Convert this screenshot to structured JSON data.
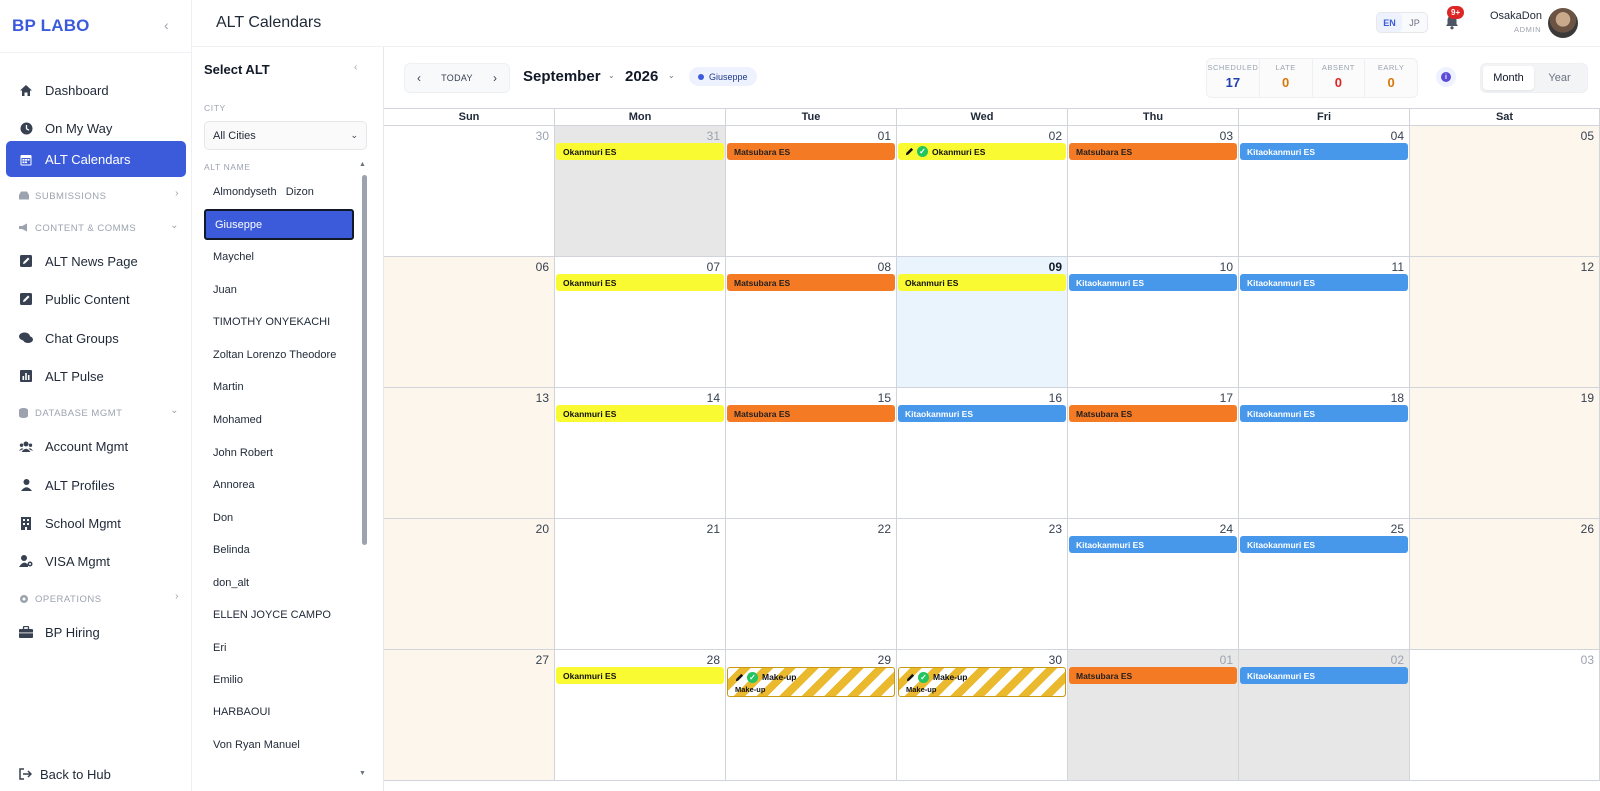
{
  "sidebar": {
    "brand": "BP LABO",
    "items": [
      {
        "label": "Dashboard"
      },
      {
        "label": "On My Way"
      },
      {
        "label": "ALT Calendars"
      },
      {
        "label": "SUBMISSIONS"
      },
      {
        "label": "CONTENT & COMMS"
      },
      {
        "label": "ALT News Page"
      },
      {
        "label": "Public Content"
      },
      {
        "label": "Chat Groups"
      },
      {
        "label": "ALT Pulse"
      },
      {
        "label": "DATABASE MGMT"
      },
      {
        "label": "Account Mgmt"
      },
      {
        "label": "ALT Profiles"
      },
      {
        "label": "School Mgmt"
      },
      {
        "label": "VISA Mgmt"
      },
      {
        "label": "OPERATIONS"
      },
      {
        "label": "BP Hiring"
      }
    ],
    "back_label": "Back to Hub"
  },
  "header": {
    "title": "ALT Calendars",
    "lang_en": "EN",
    "lang_jp": "JP",
    "notif_badge": "9+",
    "user_name": "OsakaDon",
    "user_role": "ADMIN"
  },
  "alt_panel": {
    "title": "Select ALT",
    "city_label": "CITY",
    "city_value": "All Cities",
    "name_label": "ALT NAME",
    "names": [
      "Almondyseth   Dizon",
      "Giuseppe",
      "Maychel",
      "Juan",
      "TIMOTHY ONYEKACHI",
      "Zoltan Lorenzo Theodore",
      "Martin",
      "Mohamed",
      "John Robert",
      "Annorea",
      "Don",
      "Belinda",
      "don_alt",
      "ELLEN JOYCE CAMPO",
      "Eri",
      "Emilio",
      "HARBAOUI",
      "Von Ryan Manuel"
    ],
    "selected": "Giuseppe"
  },
  "toolbar": {
    "today_label": "TODAY",
    "month": "September",
    "year": "2026",
    "chip": "Giuseppe",
    "stats": [
      {
        "label": "SCHEDULED",
        "value": "17",
        "color": "#1e40af"
      },
      {
        "label": "LATE",
        "value": "0",
        "color": "#d97706"
      },
      {
        "label": "ABSENT",
        "value": "0",
        "color": "#dc2626"
      },
      {
        "label": "EARLY",
        "value": "0",
        "color": "#d97706"
      }
    ],
    "info_icon": "i",
    "view_month": "Month",
    "view_year": "Year"
  },
  "calendar": {
    "days": [
      "Sun",
      "Mon",
      "Tue",
      "Wed",
      "Thu",
      "Fri",
      "Sat"
    ],
    "weeks": [
      [
        {
          "d": "30",
          "other": true
        },
        {
          "d": "31",
          "other": true,
          "events": [
            {
              "label": "Okanmuri ES",
              "color": "yellow"
            }
          ]
        },
        {
          "d": "01",
          "events": [
            {
              "label": "Matsubara ES",
              "color": "orange"
            }
          ]
        },
        {
          "d": "02",
          "events": [
            {
              "label": "Okanmuri ES",
              "color": "yellow",
              "check": true
            }
          ]
        },
        {
          "d": "03",
          "events": [
            {
              "label": "Matsubara ES",
              "color": "orange"
            }
          ]
        },
        {
          "d": "04",
          "events": [
            {
              "label": "Kitaokanmuri ES",
              "color": "blue"
            }
          ]
        },
        {
          "d": "05"
        }
      ],
      [
        {
          "d": "06"
        },
        {
          "d": "07",
          "events": [
            {
              "label": "Okanmuri ES",
              "color": "yellow"
            }
          ]
        },
        {
          "d": "08",
          "events": [
            {
              "label": "Matsubara ES",
              "color": "orange"
            }
          ]
        },
        {
          "d": "09",
          "today": true,
          "events": [
            {
              "label": "Okanmuri ES",
              "color": "yellow"
            }
          ]
        },
        {
          "d": "10",
          "events": [
            {
              "label": "Kitaokanmuri ES",
              "color": "blue"
            }
          ]
        },
        {
          "d": "11",
          "events": [
            {
              "label": "Kitaokanmuri ES",
              "color": "blue"
            }
          ]
        },
        {
          "d": "12"
        }
      ],
      [
        {
          "d": "13"
        },
        {
          "d": "14",
          "events": [
            {
              "label": "Okanmuri ES",
              "color": "yellow"
            }
          ]
        },
        {
          "d": "15",
          "events": [
            {
              "label": "Matsubara ES",
              "color": "orange"
            }
          ]
        },
        {
          "d": "16",
          "events": [
            {
              "label": "Kitaokanmuri ES",
              "color": "blue"
            }
          ]
        },
        {
          "d": "17",
          "events": [
            {
              "label": "Matsubara ES",
              "color": "orange"
            }
          ]
        },
        {
          "d": "18",
          "events": [
            {
              "label": "Kitaokanmuri ES",
              "color": "blue"
            }
          ]
        },
        {
          "d": "19"
        }
      ],
      [
        {
          "d": "20"
        },
        {
          "d": "21"
        },
        {
          "d": "22"
        },
        {
          "d": "23"
        },
        {
          "d": "24",
          "events": [
            {
              "label": "Kitaokanmuri ES",
              "color": "blue"
            }
          ]
        },
        {
          "d": "25",
          "events": [
            {
              "label": "Kitaokanmuri ES",
              "color": "blue"
            }
          ]
        },
        {
          "d": "26"
        }
      ],
      [
        {
          "d": "27"
        },
        {
          "d": "28",
          "events": [
            {
              "label": "Okanmuri ES",
              "color": "yellow"
            }
          ]
        },
        {
          "d": "29",
          "events": [
            {
              "label": "Make-up",
              "sub": "Make-up",
              "color": "makeup",
              "check": true
            }
          ]
        },
        {
          "d": "30",
          "events": [
            {
              "label": "Make-up",
              "sub": "Make-up",
              "color": "makeup",
              "check": true
            }
          ]
        },
        {
          "d": "01",
          "other": true,
          "events": [
            {
              "label": "Matsubara ES",
              "color": "orange"
            }
          ]
        },
        {
          "d": "02",
          "other": true,
          "events": [
            {
              "label": "Kitaokanmuri ES",
              "color": "blue"
            }
          ]
        },
        {
          "d": "03",
          "other": true
        }
      ]
    ]
  }
}
